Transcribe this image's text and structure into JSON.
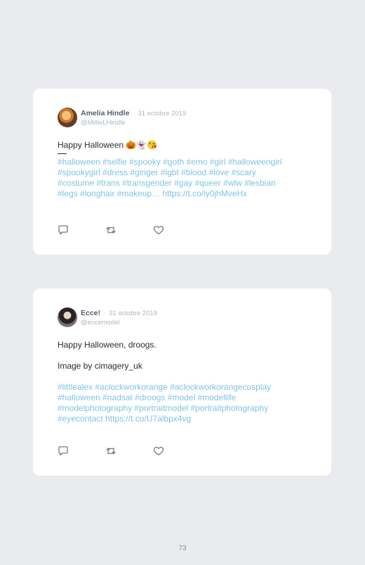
{
  "tweets": [
    {
      "name": "Amelia Hindle",
      "separator": "·",
      "date": "31 octobre 2019",
      "handle": "@MillieLHindle",
      "text_line": "Happy Halloween 🎃👻😘",
      "hashtags_lines": [
        "#halloween #selfie #spooky #goth #emo #girl #halloweengirl",
        "#spookygirl #dress #ginger #lgbt #blood #love #scary",
        "#costume #trans #transgender #gay #queer #wlw #lesbian"
      ],
      "last_line_tags": "#legs #longhair #makeup…",
      "last_line_url": "https://t.co/iy0jhMveHx"
    },
    {
      "name": "Ecce!",
      "separator": "·",
      "date": "31 octobre 2019",
      "handle": "@eccemodel",
      "text_line": "Happy Halloween, droogs.",
      "credit_line": "Image by cimagery_uk",
      "hashtags_lines": [
        "#littlealex #aclockworkorange #aclockworkorangecosplay",
        "#halloween #nadsat #droogs #model #modellife",
        "#modelphotography #portraitmodel #portraitphotography"
      ],
      "last_line_tags": "#eyecontact",
      "last_line_url": "https://t.co/U7albpx4vg"
    }
  ],
  "icons": [
    "reply-icon",
    "retweet-icon",
    "like-icon"
  ],
  "page_number": "73"
}
